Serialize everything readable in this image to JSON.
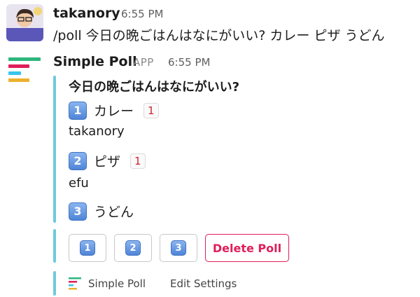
{
  "message": {
    "sender": "takanory",
    "time": "6:55 PM",
    "text": "/poll 今日の晩ごはんはなにがいい? カレー ピザ うどん"
  },
  "bot": {
    "name": "Simple Poll",
    "badge": "APP",
    "time": "6:55 PM"
  },
  "poll": {
    "question": "今日の晩ごはんはなにがいい?",
    "options": [
      {
        "key": "1",
        "label": "カレー",
        "count": "1",
        "voters": "takanory"
      },
      {
        "key": "2",
        "label": "ピザ",
        "count": "1",
        "voters": "efu"
      },
      {
        "key": "3",
        "label": "うどん",
        "count": "",
        "voters": ""
      }
    ]
  },
  "buttons": {
    "vote": [
      "1",
      "2",
      "3"
    ],
    "delete_label": "Delete Poll"
  },
  "footer": {
    "app_name": "Simple Poll",
    "edit_label": "Edit Settings"
  },
  "colors": {
    "accent_bar": "#6ecadc",
    "delete": "#e01e5a",
    "count_text": "#d1242f",
    "icon_teal": "#2eb67d",
    "icon_red": "#e01e5a",
    "icon_yellow": "#ecb22e",
    "icon_blue": "#36c5f0"
  }
}
